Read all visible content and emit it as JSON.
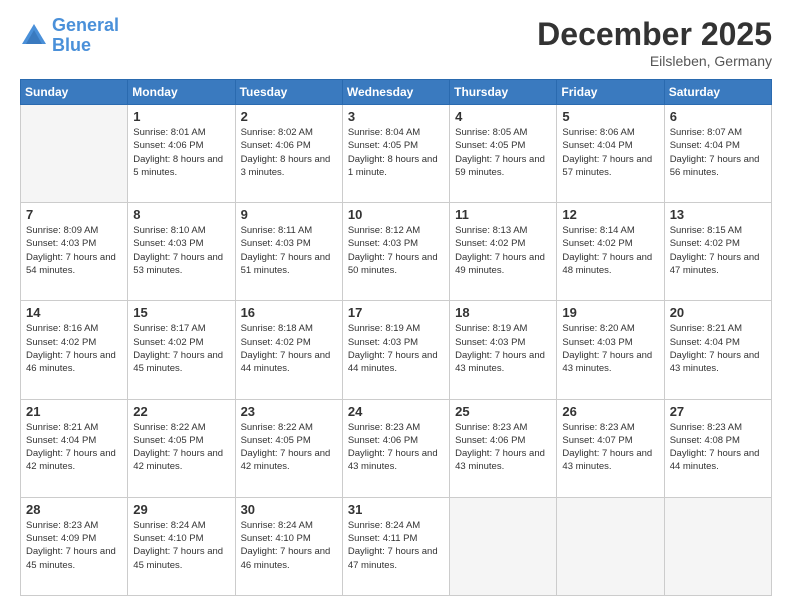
{
  "header": {
    "logo_line1": "General",
    "logo_line2": "Blue",
    "month_title": "December 2025",
    "location": "Eilsleben, Germany"
  },
  "weekdays": [
    "Sunday",
    "Monday",
    "Tuesday",
    "Wednesday",
    "Thursday",
    "Friday",
    "Saturday"
  ],
  "weeks": [
    [
      {
        "day": "",
        "sunrise": "",
        "sunset": "",
        "daylight": ""
      },
      {
        "day": "1",
        "sunrise": "8:01 AM",
        "sunset": "4:06 PM",
        "daylight": "8 hours and 5 minutes."
      },
      {
        "day": "2",
        "sunrise": "8:02 AM",
        "sunset": "4:06 PM",
        "daylight": "8 hours and 3 minutes."
      },
      {
        "day": "3",
        "sunrise": "8:04 AM",
        "sunset": "4:05 PM",
        "daylight": "8 hours and 1 minute."
      },
      {
        "day": "4",
        "sunrise": "8:05 AM",
        "sunset": "4:05 PM",
        "daylight": "7 hours and 59 minutes."
      },
      {
        "day": "5",
        "sunrise": "8:06 AM",
        "sunset": "4:04 PM",
        "daylight": "7 hours and 57 minutes."
      },
      {
        "day": "6",
        "sunrise": "8:07 AM",
        "sunset": "4:04 PM",
        "daylight": "7 hours and 56 minutes."
      }
    ],
    [
      {
        "day": "7",
        "sunrise": "8:09 AM",
        "sunset": "4:03 PM",
        "daylight": "7 hours and 54 minutes."
      },
      {
        "day": "8",
        "sunrise": "8:10 AM",
        "sunset": "4:03 PM",
        "daylight": "7 hours and 53 minutes."
      },
      {
        "day": "9",
        "sunrise": "8:11 AM",
        "sunset": "4:03 PM",
        "daylight": "7 hours and 51 minutes."
      },
      {
        "day": "10",
        "sunrise": "8:12 AM",
        "sunset": "4:03 PM",
        "daylight": "7 hours and 50 minutes."
      },
      {
        "day": "11",
        "sunrise": "8:13 AM",
        "sunset": "4:02 PM",
        "daylight": "7 hours and 49 minutes."
      },
      {
        "day": "12",
        "sunrise": "8:14 AM",
        "sunset": "4:02 PM",
        "daylight": "7 hours and 48 minutes."
      },
      {
        "day": "13",
        "sunrise": "8:15 AM",
        "sunset": "4:02 PM",
        "daylight": "7 hours and 47 minutes."
      }
    ],
    [
      {
        "day": "14",
        "sunrise": "8:16 AM",
        "sunset": "4:02 PM",
        "daylight": "7 hours and 46 minutes."
      },
      {
        "day": "15",
        "sunrise": "8:17 AM",
        "sunset": "4:02 PM",
        "daylight": "7 hours and 45 minutes."
      },
      {
        "day": "16",
        "sunrise": "8:18 AM",
        "sunset": "4:02 PM",
        "daylight": "7 hours and 44 minutes."
      },
      {
        "day": "17",
        "sunrise": "8:19 AM",
        "sunset": "4:03 PM",
        "daylight": "7 hours and 44 minutes."
      },
      {
        "day": "18",
        "sunrise": "8:19 AM",
        "sunset": "4:03 PM",
        "daylight": "7 hours and 43 minutes."
      },
      {
        "day": "19",
        "sunrise": "8:20 AM",
        "sunset": "4:03 PM",
        "daylight": "7 hours and 43 minutes."
      },
      {
        "day": "20",
        "sunrise": "8:21 AM",
        "sunset": "4:04 PM",
        "daylight": "7 hours and 43 minutes."
      }
    ],
    [
      {
        "day": "21",
        "sunrise": "8:21 AM",
        "sunset": "4:04 PM",
        "daylight": "7 hours and 42 minutes."
      },
      {
        "day": "22",
        "sunrise": "8:22 AM",
        "sunset": "4:05 PM",
        "daylight": "7 hours and 42 minutes."
      },
      {
        "day": "23",
        "sunrise": "8:22 AM",
        "sunset": "4:05 PM",
        "daylight": "7 hours and 42 minutes."
      },
      {
        "day": "24",
        "sunrise": "8:23 AM",
        "sunset": "4:06 PM",
        "daylight": "7 hours and 43 minutes."
      },
      {
        "day": "25",
        "sunrise": "8:23 AM",
        "sunset": "4:06 PM",
        "daylight": "7 hours and 43 minutes."
      },
      {
        "day": "26",
        "sunrise": "8:23 AM",
        "sunset": "4:07 PM",
        "daylight": "7 hours and 43 minutes."
      },
      {
        "day": "27",
        "sunrise": "8:23 AM",
        "sunset": "4:08 PM",
        "daylight": "7 hours and 44 minutes."
      }
    ],
    [
      {
        "day": "28",
        "sunrise": "8:23 AM",
        "sunset": "4:09 PM",
        "daylight": "7 hours and 45 minutes."
      },
      {
        "day": "29",
        "sunrise": "8:24 AM",
        "sunset": "4:10 PM",
        "daylight": "7 hours and 45 minutes."
      },
      {
        "day": "30",
        "sunrise": "8:24 AM",
        "sunset": "4:10 PM",
        "daylight": "7 hours and 46 minutes."
      },
      {
        "day": "31",
        "sunrise": "8:24 AM",
        "sunset": "4:11 PM",
        "daylight": "7 hours and 47 minutes."
      },
      {
        "day": "",
        "sunrise": "",
        "sunset": "",
        "daylight": ""
      },
      {
        "day": "",
        "sunrise": "",
        "sunset": "",
        "daylight": ""
      },
      {
        "day": "",
        "sunrise": "",
        "sunset": "",
        "daylight": ""
      }
    ]
  ]
}
